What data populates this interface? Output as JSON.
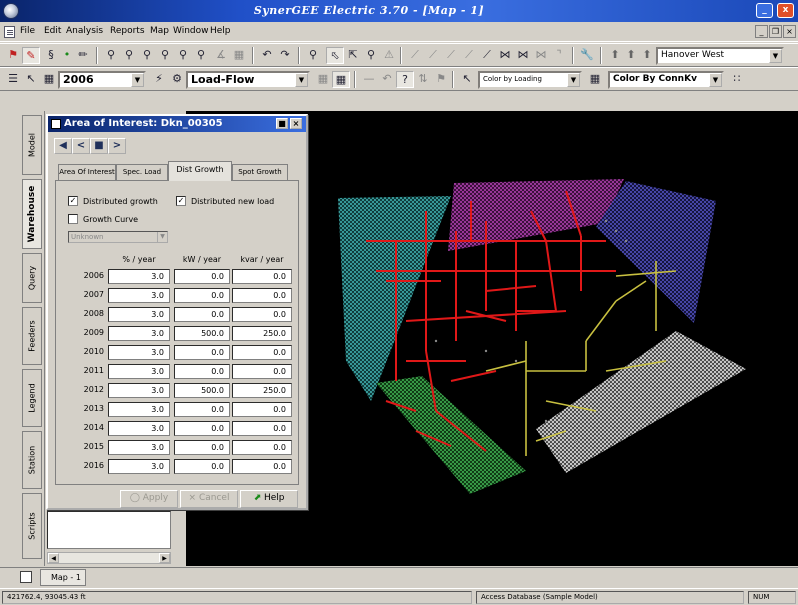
{
  "window": {
    "title": "SynerGEE Electric 3.70 - [Map - 1]",
    "minimize_glyph": "_",
    "close_glyph": "x"
  },
  "menu": {
    "items": [
      "File",
      "Edit",
      "Analysis",
      "Reports",
      "Map",
      "Window",
      "Help"
    ],
    "mdi_buttons": [
      "_",
      "&#1499;",
      "x"
    ]
  },
  "toolbar1": {
    "area_combo": "Hanover West"
  },
  "toolbar2": {
    "year_combo": "2006",
    "analysis_combo": "Load-Flow",
    "color_by_loading_combo": "Color by Loading",
    "color_by_conn_combo": "Color By ConnKv"
  },
  "left_tabs": [
    "Model",
    "Warehouse",
    "Query",
    "Feeders",
    "Legend",
    "Station",
    "Scripts"
  ],
  "dialog": {
    "title": "Area of Interest: Dkn_00305",
    "tabs": [
      "Area Of Interest",
      "Spec. Load",
      "Dist Growth",
      "Spot Growth"
    ],
    "active_tab": "Dist Growth",
    "distributed_growth_label": "Distributed growth",
    "distributed_new_load_label": "Distributed new load",
    "growth_curve_label": "Growth Curve",
    "growth_curve_value": "Unknown",
    "col_pct": "% / year",
    "col_kw": "kW / year",
    "col_kvar": "kvar / year",
    "rows": [
      {
        "year": "2006",
        "pct": "3.0",
        "kw": "0.0",
        "kvar": "0.0"
      },
      {
        "year": "2007",
        "pct": "3.0",
        "kw": "0.0",
        "kvar": "0.0"
      },
      {
        "year": "2008",
        "pct": "3.0",
        "kw": "0.0",
        "kvar": "0.0"
      },
      {
        "year": "2009",
        "pct": "3.0",
        "kw": "500.0",
        "kvar": "250.0"
      },
      {
        "year": "2010",
        "pct": "3.0",
        "kw": "0.0",
        "kvar": "0.0"
      },
      {
        "year": "2011",
        "pct": "3.0",
        "kw": "0.0",
        "kvar": "0.0"
      },
      {
        "year": "2012",
        "pct": "3.0",
        "kw": "500.0",
        "kvar": "250.0"
      },
      {
        "year": "2013",
        "pct": "3.0",
        "kw": "0.0",
        "kvar": "0.0"
      },
      {
        "year": "2014",
        "pct": "3.0",
        "kw": "0.0",
        "kvar": "0.0"
      },
      {
        "year": "2015",
        "pct": "3.0",
        "kw": "0.0",
        "kvar": "0.0"
      },
      {
        "year": "2016",
        "pct": "3.0",
        "kw": "0.0",
        "kvar": "0.0"
      }
    ],
    "apply_label": "Apply",
    "cancel_label": "Cancel",
    "help_label": "Help"
  },
  "bottom_tab": "Map - 1",
  "status": {
    "coords": "421762.4, 93045.43 ft",
    "database": "Access Database (Sample Model)",
    "num": "NUM"
  },
  "colors": {
    "title_blue": "#0a246a",
    "map_bg": "#000000",
    "feeder_red": "#e01818",
    "feeder_yellow": "#c8c040",
    "area_cyan": "#2a8a8a",
    "area_magenta": "#8a2a8a",
    "area_blue": "#3a3aa0",
    "area_green": "#2a8a3a",
    "area_gray": "#b8b8b8"
  }
}
